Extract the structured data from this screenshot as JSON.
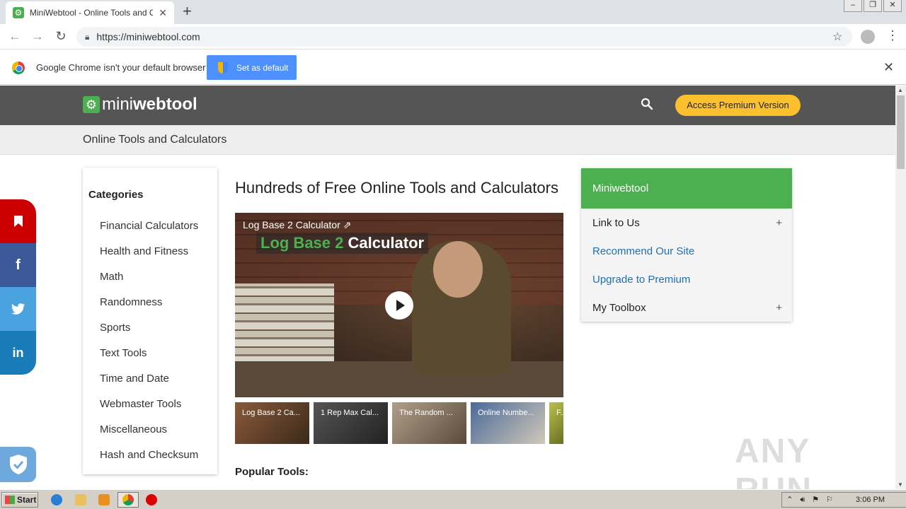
{
  "browser": {
    "tab_title": "MiniWebtool - Online Tools and Calculators",
    "tab_favicon": "gear-icon",
    "url": "https://miniwebtool.com",
    "window_controls": [
      "minimize",
      "restore",
      "close"
    ]
  },
  "infobar": {
    "message": "Google Chrome isn't your default browser",
    "button_label": "Set as default"
  },
  "site": {
    "logo_part1": "mini",
    "logo_part2": "webtool",
    "premium_label": "Access Premium Version",
    "subheader": "Online Tools and Calculators",
    "accent_color": "#4caf50",
    "premium_color": "#fbc02d"
  },
  "categories": {
    "title": "Categories",
    "items": [
      "Financial Calculators",
      "Health and Fitness",
      "Math",
      "Randomness",
      "Sports",
      "Text Tools",
      "Time and Date",
      "Webmaster Tools",
      "Miscellaneous",
      "Hash and Checksum"
    ]
  },
  "main": {
    "title": "Hundreds of Free Online Tools and Calculators",
    "video_title": "Log Base 2 Calculator",
    "video_banner_green": "Log Base 2",
    "video_banner_white": "Calculator",
    "thumbnails": [
      "Log Base 2 Ca...",
      "1 Rep Max Cal...",
      "The Random ...",
      "Online Numbe...",
      "F..."
    ],
    "popular_heading": "Popular Tools:"
  },
  "sidebar": {
    "header": "Miniwebtool",
    "items": [
      {
        "label": "Link to Us",
        "expand": "+"
      },
      {
        "label": "Recommend Our Site"
      },
      {
        "label": "Upgrade to Premium"
      },
      {
        "label": "My Toolbox",
        "expand": "+"
      }
    ]
  },
  "social": {
    "facebook_glyph": "f",
    "linkedin_glyph": "in"
  },
  "watermark": "ANY RUN",
  "taskbar": {
    "start_label": "Start",
    "clock": "3:06 PM"
  }
}
